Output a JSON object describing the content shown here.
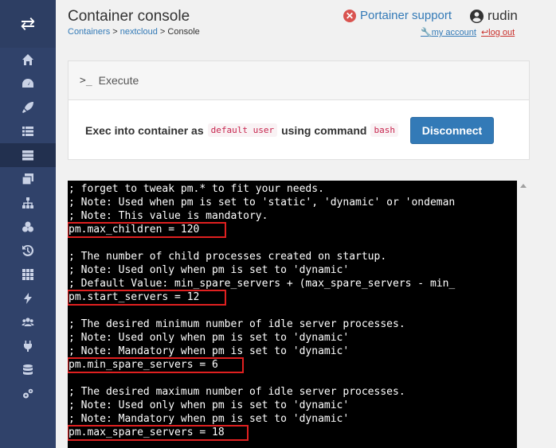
{
  "header": {
    "title": "Container console",
    "breadcrumb": {
      "containers": "Containers",
      "sep1": " > ",
      "container": "nextcloud",
      "sep2": " > ",
      "current": "Console"
    },
    "support_label": "Portainer support",
    "username": "rudin",
    "my_account_label": "my account",
    "logout_label": "log out"
  },
  "sidebar": {
    "items": [
      {
        "icon": "home-icon"
      },
      {
        "icon": "dashboard-icon"
      },
      {
        "icon": "rocket-icon"
      },
      {
        "icon": "list-icon"
      },
      {
        "icon": "containers-icon",
        "active": true
      },
      {
        "icon": "images-icon"
      },
      {
        "icon": "networks-icon"
      },
      {
        "icon": "volumes-icon"
      },
      {
        "icon": "history-icon"
      },
      {
        "icon": "grid-icon"
      },
      {
        "icon": "bolt-icon"
      },
      {
        "icon": "users-icon"
      },
      {
        "icon": "plug-icon"
      },
      {
        "icon": "database-icon"
      },
      {
        "icon": "settings-icon"
      }
    ]
  },
  "execute": {
    "title": "Execute",
    "text_before": "Exec into container as",
    "user_code": "default user",
    "text_middle": "using command",
    "command_code": "bash",
    "disconnect_label": "Disconnect"
  },
  "terminal": {
    "lines": [
      "; forget to tweak pm.* to fit your needs.",
      "; Note: Used when pm is set to 'static', 'dynamic' or 'ondeman",
      "; Note: This value is mandatory.",
      "pm.max_children = 120",
      "",
      "; The number of child processes created on startup.",
      "; Note: Used only when pm is set to 'dynamic'",
      "; Default Value: min_spare_servers + (max_spare_servers - min_",
      "pm.start_servers = 12",
      "",
      "; The desired minimum number of idle server processes.",
      "; Note: Used only when pm is set to 'dynamic'",
      "; Note: Mandatory when pm is set to 'dynamic'",
      "pm.min_spare_servers = 6",
      "",
      "; The desired maximum number of idle server processes.",
      "; Note: Used only when pm is set to 'dynamic'",
      "; Note: Mandatory when pm is set to 'dynamic'",
      "pm.max_spare_servers = 18"
    ]
  },
  "colors": {
    "sidebar": "#30426a",
    "accent": "#337ab7",
    "highlight": "#e02020",
    "terminal_bg": "#000000"
  }
}
